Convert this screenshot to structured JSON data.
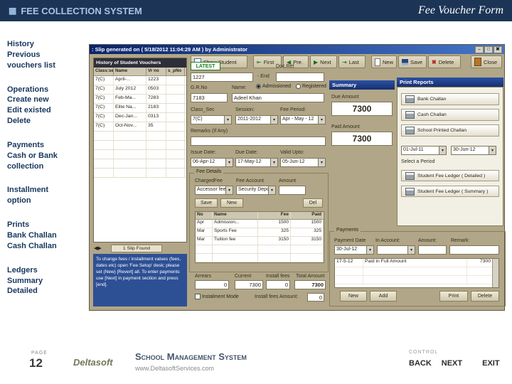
{
  "colors": {
    "banner_navy": "#1c3557",
    "sidebar_text": "#17375d",
    "app_tan": "#b1a687",
    "titlebar_blue": "#0a246a",
    "panel_header_blue": "#16306e",
    "latest_green": "#1e7d1e",
    "help_box_blue": "#2d4f94"
  },
  "icons": {
    "app_window": "▦",
    "minimize": "–",
    "maximize": "□",
    "close": "✖",
    "first": "⇤",
    "prev": "◀",
    "next": "▶",
    "last": "⇥",
    "dropdown": "▾",
    "delete": "✖",
    "panel_arrows": "◀▶"
  },
  "header": {
    "title": "FEE COLLECTION SYSTEM",
    "form_name": "Fee Voucher Form"
  },
  "sidebar": {
    "groups": [
      {
        "lines": [
          "History",
          "Previous",
          "vouchers list"
        ]
      },
      {
        "lines": [
          "Operations",
          "Create new",
          "Edit existed",
          "Delete"
        ]
      },
      {
        "lines": [
          "Payments",
          "Cash or Bank",
          "collection"
        ]
      },
      {
        "lines": [
          "Installment",
          "option"
        ]
      },
      {
        "lines": [
          "Prints",
          "Bank Challan",
          "Cash Challan"
        ]
      },
      {
        "lines": [
          "Ledgers",
          "Summary",
          "Detailed"
        ]
      }
    ]
  },
  "app": {
    "titlebar": {
      "text": ": Slip generated on ( 5/18/2012 11:04:29 AM ) by Administrator"
    },
    "toolbar": {
      "show_student": "Show Student",
      "first": "First",
      "prev": "Pre.",
      "next": "Next",
      "last": "Last",
      "new": "New",
      "save": "Save",
      "delete": "Delete",
      "close": "Close"
    },
    "history": {
      "title": "History of Student Vouchers",
      "columns": [
        "Class:sec",
        "Name",
        "Vr no",
        "s_pNo"
      ],
      "rows": [
        [
          "7(C)",
          "April-...",
          "1223",
          ""
        ],
        [
          "7(C)",
          "July 2012",
          "0503",
          ""
        ],
        [
          "7(C)",
          "Feb-Ma...",
          "7283",
          ""
        ],
        [
          "7(C)",
          "Elite Na...",
          "2183",
          ""
        ],
        [
          "7(C)",
          "Dec-Jan...",
          "0313",
          ""
        ],
        [
          "7(C)",
          "Oct-Nov...",
          "35",
          ""
        ]
      ],
      "status": "1 Slip Found"
    },
    "helpbox": {
      "text": "To change fees / installment values (fees, dates etc) open 'Fee Setup' desk; please set (New) [Revert] all. To enter payments use [Next] in payment section and press [end]."
    },
    "form": {
      "latest": "LATEST",
      "doc_ref_label": "Doc.Ref",
      "voucher_no": "1227",
      "voucher_suffix": "- End",
      "gr_label": "G.R.No",
      "gr_no": "7183",
      "name_label": "Name:",
      "name_value": "Adeel Khan",
      "radio_admissioned": "Admissioned",
      "radio_registered": "Registered",
      "class_label": "Class_Sec",
      "class_value": "7(C)",
      "session_label": "Session:",
      "session_value": "2011-2012",
      "period_label": "Fee Period:",
      "period_value": "Apr - May - 12",
      "remarks_label": "Remarks (If Any)",
      "remarks_value": "",
      "issue_label": "Issue Date:",
      "issue_value": "06-Apr-12",
      "due_label": "Due Date:",
      "due_value": "17-May-12",
      "valid_label": "Valid Upto:",
      "valid_value": "05-Jun-12"
    },
    "fee_details": {
      "title": "Fee Details",
      "charged_label": "ChargedFee",
      "account_label": "Fee Account",
      "amount_label": "Amount",
      "charged_value": "Accessor fee",
      "account_value": "Security Deposit",
      "amount_value": "",
      "save": "Save",
      "new": "New",
      "del": "Del",
      "columns": [
        "No",
        "Name",
        "Fee",
        "Paid"
      ],
      "rows": [
        [
          "Apr",
          "Admission...",
          "1500",
          "1500"
        ],
        [
          "Mar",
          "Sports Fee",
          "325",
          "325"
        ],
        [
          "Mar",
          "Tuition fee",
          "3150",
          "3150"
        ]
      ]
    },
    "totals": {
      "arrears_label": "Arrears",
      "arrears": "0",
      "current_label": "Current",
      "current": "7300",
      "install_label": "Install fees",
      "install": "0",
      "total_label": "Total Amount",
      "total": "7300",
      "instalment_mode": "Instalment Mode",
      "install_amount_label": "Install fees Amount:",
      "install_amount": "0"
    },
    "summary": {
      "title": "Summary",
      "due_label": "Due Amount",
      "due_value": "7300",
      "paid_label": "Paid Amount",
      "paid_value": "7300"
    },
    "reports": {
      "title": "Print Reports",
      "bank_challan": "Bank Challan",
      "cash_challan": "Cash Challan",
      "school_challan": "School Printed Challan",
      "from_value": "01-Jul-11",
      "to_value": "30-Jun-12",
      "select_label": "Select a Period",
      "ledger_detailed": "Student Fee Ledger ( Detailed )",
      "ledger_summary": "Student Fee Ledger ( Summary )"
    },
    "payments": {
      "title": "Payments",
      "date_label": "Payment Date",
      "account_label": "In Account:",
      "amount_label": "Amount:",
      "remark_label": "Remark:",
      "date_value": "30-Jul-12",
      "account_value": "",
      "amount_value": "",
      "remark_value": "",
      "rows": [
        [
          "17-5-12",
          "Paid in Full Amount",
          "7300"
        ]
      ],
      "new": "New",
      "add": "Add",
      "print": "Print",
      "delete": "Delete"
    }
  },
  "footer": {
    "page_label": "PAGE",
    "page_number": "12",
    "brand": "Deltasoft",
    "system_name": "School Management System",
    "website": "www.DeltasoftServices.com",
    "control_label": "CONTROL",
    "back": "BACK",
    "next": "NEXT",
    "exit": "EXIT"
  }
}
